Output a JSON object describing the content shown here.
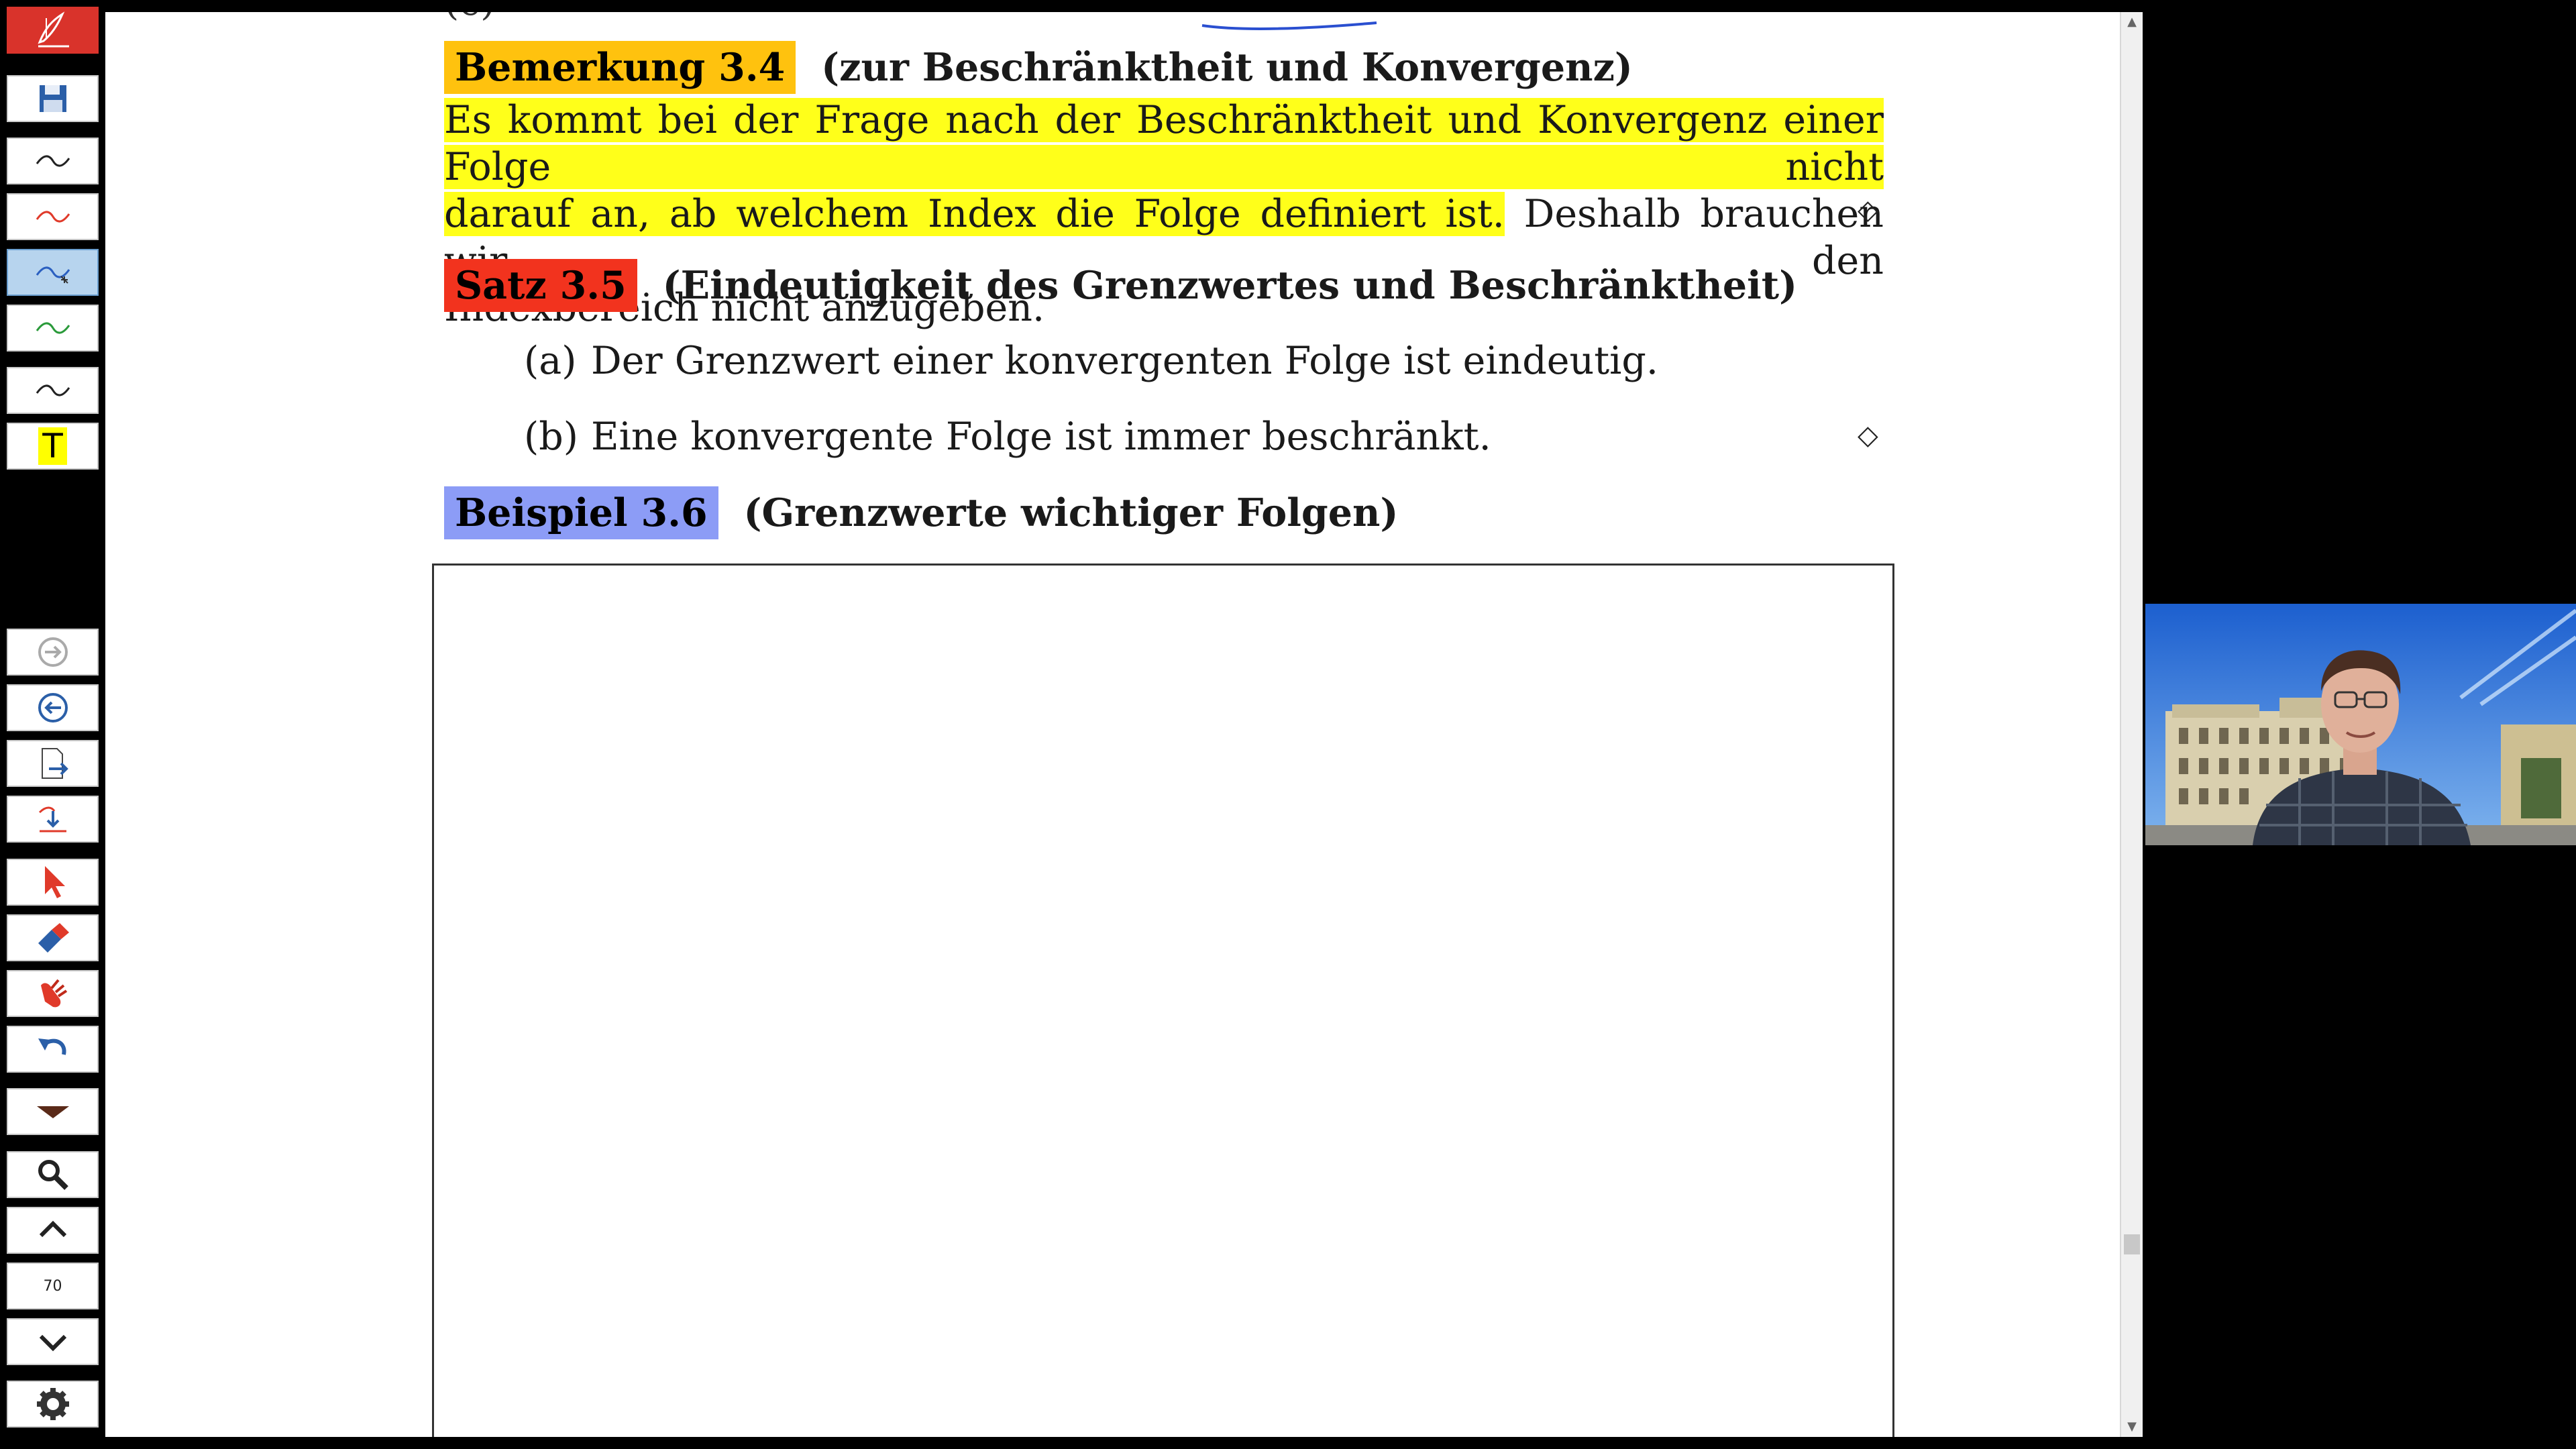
{
  "toolbar": {
    "top_tools": [
      {
        "name": "app-logo-button",
        "icon": "feather-pen-icon"
      },
      {
        "name": "save-button",
        "icon": "floppy-disk-icon"
      },
      {
        "name": "pen-black-button",
        "icon": "pen-stroke-icon",
        "color": "#222222"
      },
      {
        "name": "pen-red-button",
        "icon": "pen-stroke-icon",
        "color": "#e03a2a"
      },
      {
        "name": "pen-blue-button",
        "icon": "pen-stroke-icon",
        "color": "#2a5fc0"
      },
      {
        "name": "pen-green-button",
        "icon": "pen-stroke-icon",
        "color": "#2a9a3a"
      },
      {
        "name": "pen-dark-button",
        "icon": "pen-stroke-icon",
        "color": "#222222"
      },
      {
        "name": "text-tool-button",
        "icon": "text-t-icon",
        "label": "T"
      }
    ],
    "bottom_tools": [
      {
        "name": "forward-button",
        "icon": "arrow-right-circle-icon"
      },
      {
        "name": "back-button",
        "icon": "arrow-left-circle-icon"
      },
      {
        "name": "export-page-button",
        "icon": "page-export-icon"
      },
      {
        "name": "insert-page-button",
        "icon": "insert-page-icon"
      },
      {
        "name": "pointer-button",
        "icon": "cursor-arrow-icon"
      },
      {
        "name": "eraser-button",
        "icon": "eraser-icon"
      },
      {
        "name": "clear-button",
        "icon": "hand-wipe-icon"
      },
      {
        "name": "undo-button",
        "icon": "undo-icon"
      },
      {
        "name": "menu-dropdown-button",
        "icon": "caret-down-icon"
      },
      {
        "name": "zoom-button",
        "icon": "magnifier-icon"
      },
      {
        "name": "page-up-button",
        "icon": "chevron-up-icon"
      },
      {
        "name": "page-number",
        "icon": "",
        "label": "70"
      },
      {
        "name": "page-down-button",
        "icon": "chevron-down-icon"
      },
      {
        "name": "settings-button",
        "icon": "gear-icon"
      }
    ]
  },
  "document": {
    "cutoff_line": "(c)",
    "bemerkung": {
      "label": "Bemerkung 3.4",
      "title": "(zur Beschränktheit und Konvergenz)",
      "line1": "Es kommt bei der Frage nach der Beschränktheit und Konvergenz einer Folge nicht",
      "line2_highlight": "darauf an, ab welchem Index die Folge definiert ist.",
      "line2_rest": " Deshalb brauchen wir den",
      "line3": "Indexbereich nicht anzugeben.",
      "end_mark": "◇"
    },
    "satz": {
      "label": "Satz 3.5",
      "title": "(Eindeutigkeit des Grenzwertes und Beschränktheit)",
      "items": [
        {
          "label": "(a)",
          "text": "Der Grenzwert einer konvergenten Folge ist eindeutig."
        },
        {
          "label": "(b)",
          "text": "Eine konvergente Folge ist immer beschränkt."
        }
      ],
      "end_mark": "◇"
    },
    "beispiel": {
      "label": "Beispiel 3.6",
      "title": "(Grenzwerte wichtiger Folgen)"
    }
  },
  "scrollbar": {
    "up": "▲",
    "down": "▼",
    "position": 0.86
  }
}
